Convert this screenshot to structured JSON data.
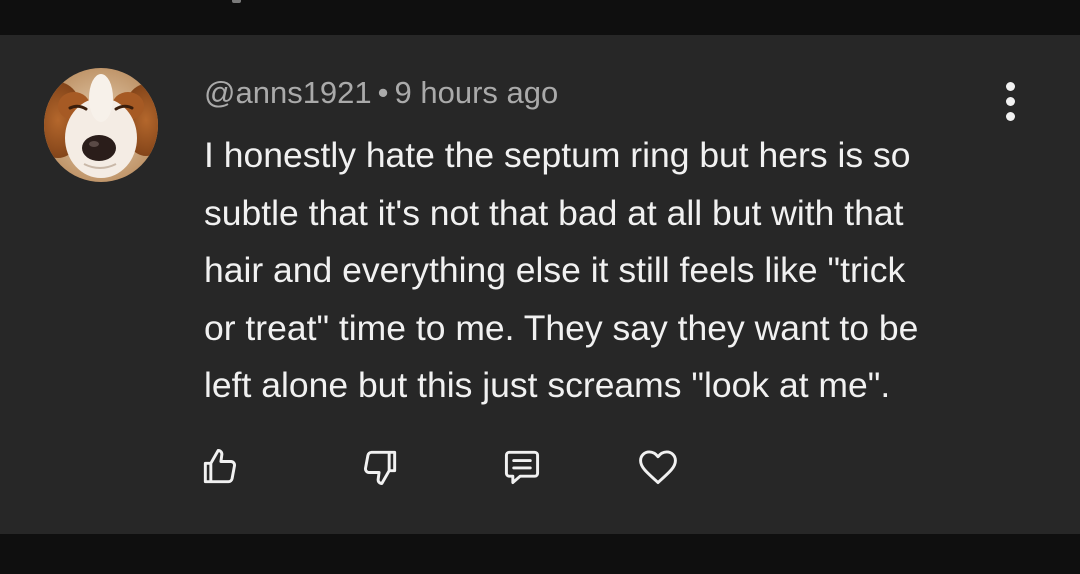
{
  "comment": {
    "author": "@anns1921",
    "separator": "•",
    "timestamp": "9 hours ago",
    "text": "I honestly hate the septum ring but hers is so\nsubtle that it's not that bad at all but with that\nhair and everything else it still feels like \"trick\nor treat\" time to me.  They say they want to be\nleft alone but this just screams \"look at me\"."
  },
  "icons": {
    "avatar": "dog-avatar",
    "more": "more-vertical-icon",
    "like": "thumbs-up-icon",
    "dislike": "thumbs-down-icon",
    "reply": "reply-comment-icon",
    "heart": "heart-icon"
  },
  "colors": {
    "card_background": "#272727",
    "page_background": "#0f0f0f",
    "primary_text": "#f1f1f1",
    "secondary_text": "#aaaaaa"
  }
}
